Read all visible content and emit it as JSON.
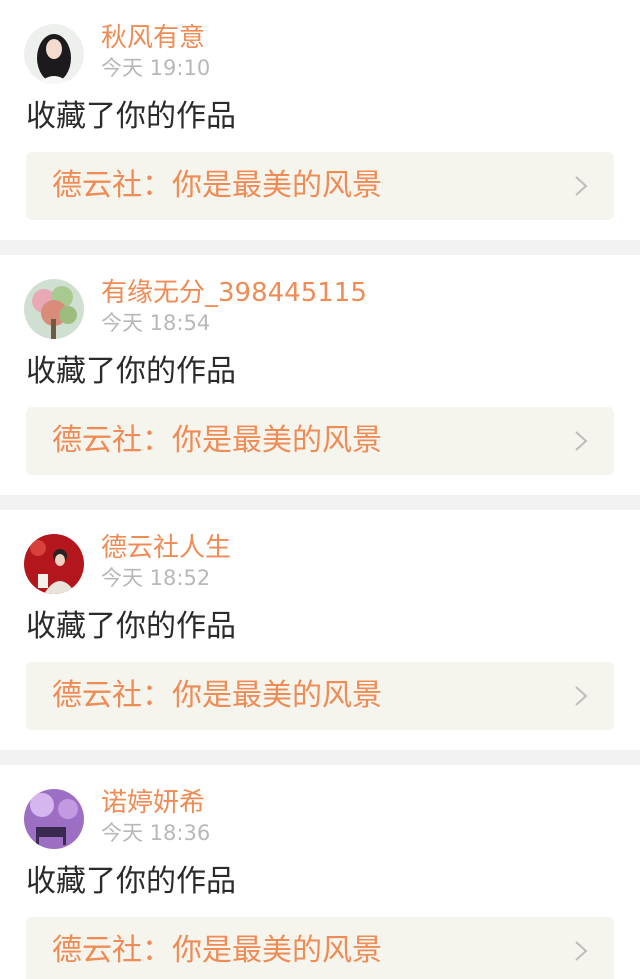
{
  "notifications": [
    {
      "username": "秋风有意",
      "time": "今天 19:10",
      "action": "收藏了你的作品",
      "work_title": "德云社：你是最美的风景",
      "avatar_icon": "girl-portrait-avatar"
    },
    {
      "username": "有缘无分_398445115",
      "time": "今天 18:54",
      "action": "收藏了你的作品",
      "work_title": "德云社：你是最美的风景",
      "avatar_icon": "flower-tree-avatar"
    },
    {
      "username": "德云社人生",
      "time": "今天 18:52",
      "action": "收藏了你的作品",
      "work_title": "德云社：你是最美的风景",
      "avatar_icon": "performer-red-avatar"
    },
    {
      "username": "诺婷妍希",
      "time": "今天 18:36",
      "action": "收藏了你的作品",
      "work_title": "德云社：你是最美的风景",
      "avatar_icon": "purple-piano-avatar"
    }
  ],
  "colors": {
    "username": "#ef8b55",
    "work_title": "#ef8b55",
    "time": "#b8b8b8",
    "action": "#2b2b2b",
    "link_background": "#f5f5ee",
    "page_background": "#f2f2f2"
  }
}
